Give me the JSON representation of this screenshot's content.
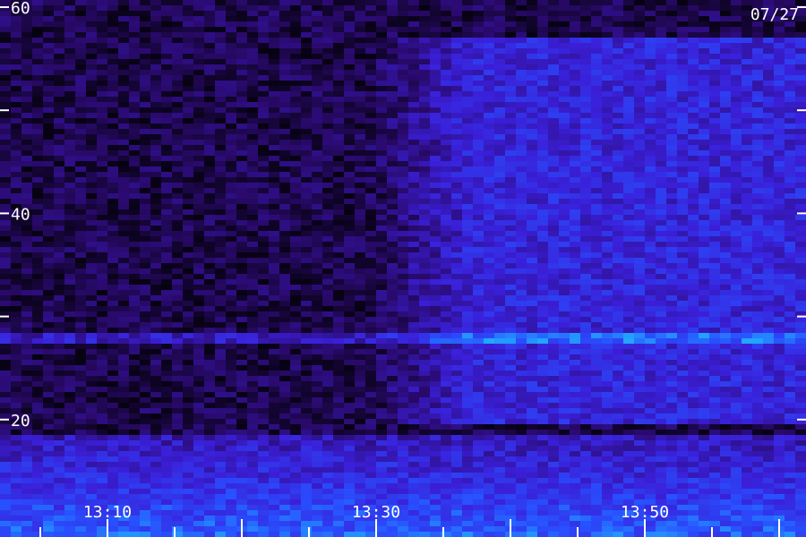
{
  "chart_data": {
    "type": "heatmap",
    "title": "",
    "date_label": "07/27",
    "xlabel": "",
    "ylabel": "",
    "y_ticks_labeled": [
      {
        "value": 60,
        "label": "60"
      },
      {
        "value": 40,
        "label": "40"
      },
      {
        "value": 20,
        "label": "20"
      }
    ],
    "y_ticks_minor": [
      50,
      30
    ],
    "x_ticks_labeled": [
      {
        "minute": 10,
        "label": "13:10"
      },
      {
        "minute": 30,
        "label": "13:30"
      },
      {
        "minute": 50,
        "label": "13:50"
      }
    ],
    "x_range_minutes": [
      2,
      62
    ],
    "y_range": [
      10,
      60
    ],
    "grid": false,
    "colormap": [
      "#000000",
      "#2a0a6e",
      "#3a1fd8",
      "#2850ff",
      "#20c8ff",
      "#20ff90"
    ],
    "background_color": "#000000",
    "text_color": "#ffffff",
    "features": {
      "enhanced_region_start_minute": 29,
      "line_feature_level": 28
    }
  }
}
